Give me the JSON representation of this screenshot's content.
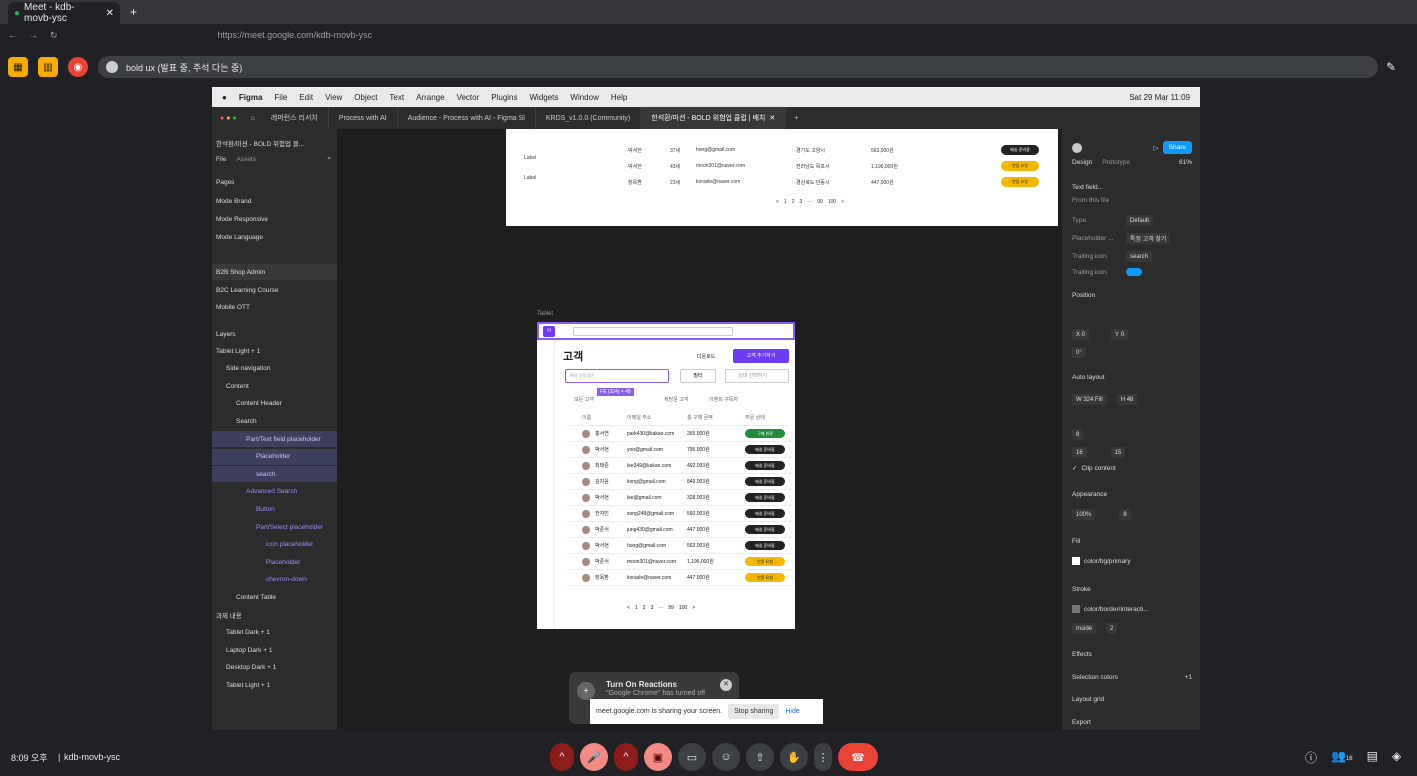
{
  "browser": {
    "tab_title": "Meet - kdb-movb-ysc",
    "url": "https://meet.google.com/kdb-movb-ysc"
  },
  "meet_top": {
    "presenter_pill": "bold ux (발표 중, 주석 다는 중)"
  },
  "mac_menu": {
    "app": "Figma",
    "items": [
      "File",
      "Edit",
      "View",
      "Object",
      "Text",
      "Arrange",
      "Vector",
      "Plugins",
      "Widgets",
      "Window",
      "Help"
    ],
    "clock": "Sat 29 Mar  11:09"
  },
  "figma_tabs": [
    "레퍼런스 리서치",
    "Process with AI",
    "Audience - Process with AI - Figma Sl",
    "KRDS_v1.0.0 (Community)",
    "한석환/미션 - BOLD 위험업 클럽 | 배치"
  ],
  "left_panel": {
    "file_title": "한석환/미션 - BOLD 위험업 클...",
    "tab_file": "File",
    "tab_assets": "Assets",
    "pages_title": "Pages",
    "pages": [
      "Mode Brand",
      "Mode Responsive",
      "Mode Language",
      "B2B Shop Admin",
      "B2C Learning Course",
      "Mobile OTT"
    ],
    "layers_title": "Layers",
    "layers": [
      {
        "label": "Tablet  Light + 1",
        "indent": 0,
        "sel": false
      },
      {
        "label": "Side navigation",
        "indent": 1,
        "sel": false
      },
      {
        "label": "Content",
        "indent": 1,
        "sel": false
      },
      {
        "label": "Content Header",
        "indent": 2,
        "sel": false
      },
      {
        "label": "Search",
        "indent": 2,
        "sel": false
      },
      {
        "label": "Part/Text field placeholder",
        "indent": 3,
        "sel": true
      },
      {
        "label": "Placeholder",
        "indent": 4,
        "sel": true
      },
      {
        "label": "search",
        "indent": 4,
        "sel": true
      },
      {
        "label": "Advanced Search",
        "indent": 3,
        "sel": false
      },
      {
        "label": "Button",
        "indent": 4,
        "sel": false
      },
      {
        "label": "Part/Select placeholder",
        "indent": 4,
        "sel": false
      },
      {
        "label": "icon placeholder",
        "indent": 5,
        "sel": false
      },
      {
        "label": "Placeholder",
        "indent": 5,
        "sel": false
      },
      {
        "label": "chevron-down",
        "indent": 5,
        "sel": false
      },
      {
        "label": "Content Table",
        "indent": 2,
        "sel": false
      },
      {
        "label": "과제 내용",
        "indent": 0,
        "sel": false
      },
      {
        "label": "Tablet  Dark + 1",
        "indent": 1,
        "sel": false
      },
      {
        "label": "Laptop  Dark + 1",
        "indent": 1,
        "sel": false
      },
      {
        "label": "Desktop  Dark + 1",
        "indent": 1,
        "sel": false
      },
      {
        "label": "Tablet  Light + 1",
        "indent": 1,
        "sel": false
      }
    ]
  },
  "right_panel": {
    "tab_design": "Design",
    "tab_prototype": "Prototype",
    "zoom": "61%",
    "share": "Share",
    "component": "Text field...",
    "from_file": "From this file",
    "type_label": "Type",
    "type_value": "Default",
    "placeholder_label": "Placeholder ...",
    "placeholder_value": "특정 고객 찾기",
    "trailing_icon_label": "Trailing icon",
    "trailing_icon_value": "search",
    "trailing_icon_toggle": "Trailing icon",
    "position": "Position",
    "x": "0",
    "y": "0",
    "rotation": "0°",
    "auto_layout": "Auto layout",
    "w": "324",
    "w_mode": "Fill",
    "h": "48",
    "gap": "8",
    "pad_h": "16",
    "pad_v": "15",
    "clip": "Clip content",
    "appearance": "Appearance",
    "opacity": "100%",
    "radius": "8",
    "fill": "Fill",
    "fill_value": "color/bg/primary",
    "stroke": "Stroke",
    "stroke_value": "color/border/interacti...",
    "stroke_pos": "Inside",
    "stroke_w": "2",
    "effects": "Effects",
    "selection_colors": "Selection colors",
    "selection_more": "+1",
    "layout_grid": "Layout grid",
    "export": "Export"
  },
  "top_frame": {
    "rows": [
      {
        "name": "박서현",
        "age": "37세",
        "email": "hong@gmail.com",
        "addr": "경기도 고양시",
        "amount": "563,000원",
        "status": "배송 준비중"
      },
      {
        "name": "박서현",
        "age": "43세",
        "email": "moon301@naver.com",
        "addr": "전라남도 목포시",
        "amount": "1,196,000원",
        "status": "반품 요청"
      },
      {
        "name": "장옥환",
        "age": "23세",
        "email": "korasle@naver.com",
        "addr": "경상북도 안동시",
        "amount": "447,000원",
        "status": "반품 요청"
      }
    ],
    "label1": "Label",
    "label2": "Label",
    "pagination": [
      "<",
      "1",
      "2",
      "3",
      "···",
      "99",
      "100",
      ">"
    ]
  },
  "tablet": {
    "frame_label": "Tablet",
    "title": "고객",
    "download": "다운로드",
    "add": "고객 추가하기",
    "search_placeholder": "특정 고객 찾기",
    "filter": "필터",
    "select_placeholder": "상태 선택하기",
    "size_tag": "Fill (324) × 48",
    "tabs": [
      "모든 고객",
      "",
      "재방문 고객",
      "이벤트 구독자"
    ],
    "headers": [
      "이름",
      "이메일 주소",
      "총 구매 금액",
      "주문 상태"
    ],
    "rows": [
      {
        "name": "홍서연",
        "email": "park430@kakao.com",
        "amount": "265,000원",
        "status": "구매 완료",
        "kind": "green"
      },
      {
        "name": "박서현",
        "email": "yoo@gmail.com",
        "amount": "795,000원",
        "status": "배송 준비중",
        "kind": "dark"
      },
      {
        "name": "최태준",
        "email": "lee349@kakao.com",
        "amount": "492,093원",
        "status": "배송 준비중",
        "kind": "dark"
      },
      {
        "name": "김지윤",
        "email": "kong@gmail.com",
        "amount": "849,003원",
        "status": "배송 준비중",
        "kind": "dark"
      },
      {
        "name": "박서현",
        "email": "lee@gmail.com",
        "amount": "328,003원",
        "status": "배송 준비중",
        "kind": "dark"
      },
      {
        "name": "한지민",
        "email": "song248@gmail.com",
        "amount": "560,003원",
        "status": "배송 준비중",
        "kind": "dark"
      },
      {
        "name": "박준서",
        "email": "jung430@gmail.com",
        "amount": "447,000원",
        "status": "배송 준비중",
        "kind": "dark"
      },
      {
        "name": "박서현",
        "email": "hong@gmail.com",
        "amount": "563,003원",
        "status": "배송 준비중",
        "kind": "dark"
      },
      {
        "name": "박준서",
        "email": "moon301@naver.com",
        "amount": "1,196,000원",
        "status": "반품 요청",
        "kind": "yellow"
      },
      {
        "name": "장옥환",
        "email": "korasle@naver.com",
        "amount": "447,000원",
        "status": "반품 요청",
        "kind": "yellow"
      }
    ],
    "pagination": [
      "<",
      "1",
      "2",
      "3",
      "···",
      "99",
      "100",
      ">"
    ]
  },
  "toast": {
    "title": "Turn On Reactions",
    "subtitle": "\"Google Chrome\" has turned off",
    "sharing_text": "meet.google.com is sharing your screen.",
    "stop": "Stop sharing",
    "hide": "Hide"
  },
  "bottom": {
    "time": "8:09 오후",
    "code": "kdb-movb-ysc",
    "people_count": "16",
    "alert": "!"
  },
  "colors": {
    "accent": "#6c3bf5",
    "end_call": "#ea4335",
    "mute_red": "#8c1d18"
  }
}
